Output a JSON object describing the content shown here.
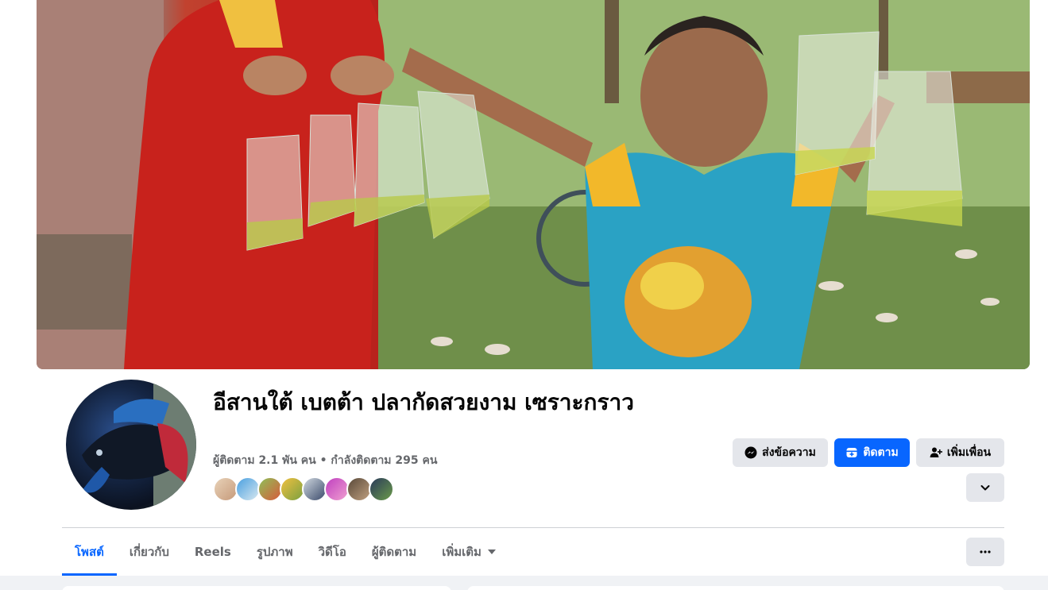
{
  "profile": {
    "name": "อีสานใต้ เบตต้า ปลากัดสวยงาม เซราะกราว",
    "followers_line": "ผู้ติดตาม 2.1 พัน คน • กำลังติดตาม 295 คน"
  },
  "actions": {
    "message_label": "ส่งข้อความ",
    "follow_label": "ติดตาม",
    "add_friend_label": "เพิ่มเพื่อน"
  },
  "tabs": [
    {
      "label": "โพสต์"
    },
    {
      "label": "เกี่ยวกับ"
    },
    {
      "label": "Reels"
    },
    {
      "label": "รูปภาพ"
    },
    {
      "label": "วิดีโอ"
    },
    {
      "label": "ผู้ติดตาม"
    },
    {
      "label": "เพิ่มเติม"
    }
  ],
  "colors": {
    "accent": "#0866ff",
    "button_gray": "#e4e6eb",
    "muted_text": "#65676b",
    "background": "#f0f2f5"
  },
  "icons": {
    "message": "messenger-icon",
    "follow": "follow-icon",
    "add_friend": "add-friend-icon",
    "expand": "chevron-down-icon",
    "more": "more-dots-icon"
  }
}
